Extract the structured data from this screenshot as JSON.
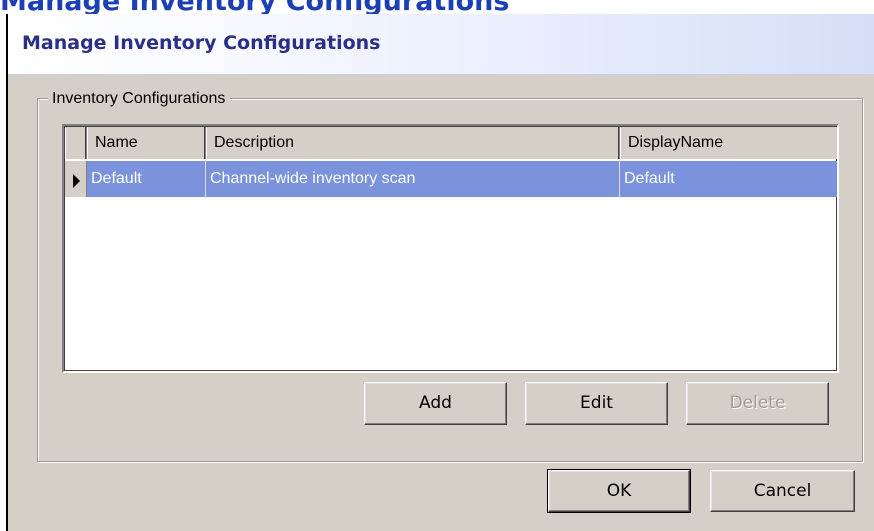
{
  "background_heading": "Manage Inventory Configurations",
  "dialog": {
    "title": "Manage Inventory Configurations"
  },
  "group": {
    "label": "Inventory Configurations"
  },
  "grid": {
    "columns": [
      "Name",
      "Description",
      "DisplayName"
    ],
    "rows": [
      {
        "selected": true,
        "name": "Default",
        "description": "Channel-wide inventory scan",
        "display_name": "Default"
      }
    ]
  },
  "buttons": {
    "add": "Add",
    "edit": "Edit",
    "delete": "Delete",
    "ok": "OK",
    "cancel": "Cancel"
  },
  "colors": {
    "selection": "#7b93dc",
    "dialog_face": "#d4d0c8",
    "title_text": "#2b2f85",
    "background_heading": "#1b3fb5"
  },
  "icons": {
    "row_indicator": "current-row-arrow-icon"
  }
}
